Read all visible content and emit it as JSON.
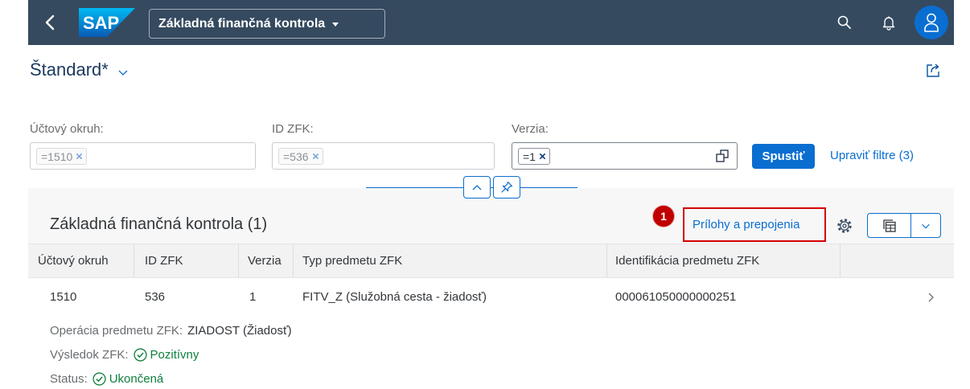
{
  "colors": {
    "shell_background": "#354a5f",
    "accent": "#0a6ed1",
    "success": "#107e3e",
    "annotation": "#c00000"
  },
  "shell": {
    "logo_text": "SAP",
    "app_title": "Základná finančná kontrola",
    "icons": {
      "back": "nav-back-icon",
      "title_menu": "dropdown-triangle-icon",
      "search": "search-icon",
      "notifications": "notification-bell-icon",
      "user": "user-avatar-icon"
    }
  },
  "variant": {
    "name": "Štandard*",
    "icons": {
      "menu": "chevron-down-icon",
      "share": "share-icon"
    }
  },
  "filter_bar": {
    "fields": [
      {
        "label": "Účtový okruh:",
        "token": "=1510"
      },
      {
        "label": "ID ZFK:",
        "token": "=536"
      },
      {
        "label": "Verzia:",
        "token": "=1"
      }
    ],
    "go_button": "Spustiť",
    "adapt_filters_link": "Upraviť filtre (3)",
    "icons": {
      "remove_token": "token-remove-icon",
      "value_help": "value-help-icon",
      "collapse": "chevron-up-icon",
      "pin": "pin-icon"
    }
  },
  "table": {
    "title": "Základná finančná kontrola (1)",
    "annotation_number": "1",
    "attachments_button": "Prílohy a prepojenia",
    "icons": {
      "settings": "gear-icon",
      "view": "table-view-icon",
      "view_menu": "chevron-down-icon",
      "row_navigation": "chevron-right-icon",
      "status": "check-circle-icon"
    },
    "columns": [
      "Účtový okruh",
      "ID ZFK",
      "Verzia",
      "Typ predmetu ZFK",
      "Identifikácia predmetu ZFK"
    ],
    "rows": [
      {
        "cells": [
          "1510",
          "536",
          "1",
          "FITV_Z (Služobná cesta - žiadosť)",
          "000061050000000251"
        ],
        "details": [
          {
            "label": "Operácia predmetu ZFK:",
            "value": "ZIADOST (Žiadosť)"
          },
          {
            "label": "Výsledok ZFK:",
            "value": "Pozitívny",
            "value_color": "#107e3e"
          },
          {
            "label": "Status:",
            "value": "Ukončená",
            "value_color": "#107e3e"
          }
        ]
      }
    ]
  }
}
